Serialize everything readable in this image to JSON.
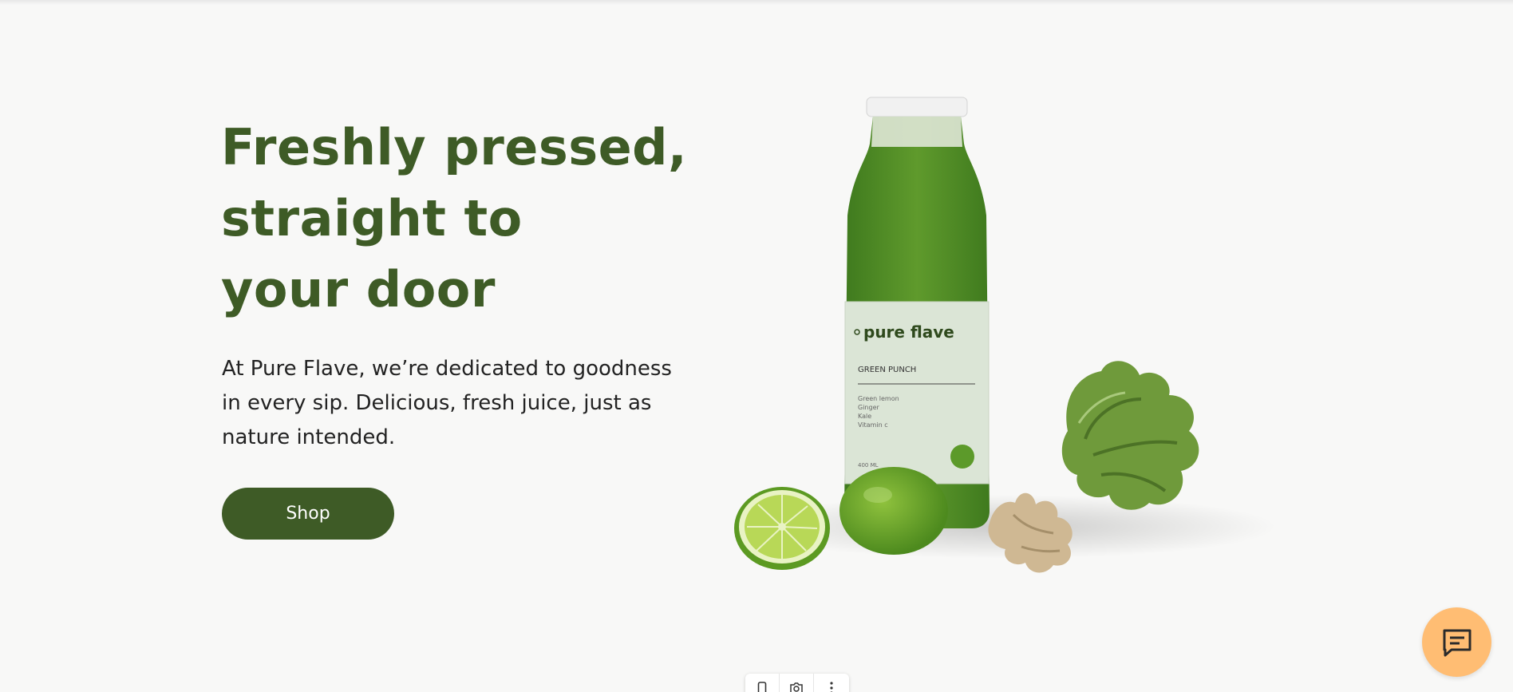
{
  "hero": {
    "title_lines": [
      "Freshly pressed,",
      "straight to",
      "your door"
    ],
    "description_lines": [
      "At Pure Flave, we’re dedicated to goodness",
      "in every sip. Delicious, fresh juice, just as",
      "nature intended."
    ],
    "cta_label": "Shop"
  },
  "product_label": {
    "brand": "pure flave",
    "name": "GREEN PUNCH",
    "ingredients": [
      "Green lemon",
      "Ginger",
      "Kale",
      "Vitamin c"
    ],
    "volume": "400 ML"
  },
  "colors": {
    "brand_green": "#3e5b26",
    "chat_orange": "#ffbd73",
    "background": "#f8f8f7"
  },
  "icons": {
    "chat": "chat-bubble-icon",
    "toolbar": [
      "mobile-icon",
      "camera-icon",
      "more-vertical-icon"
    ]
  }
}
